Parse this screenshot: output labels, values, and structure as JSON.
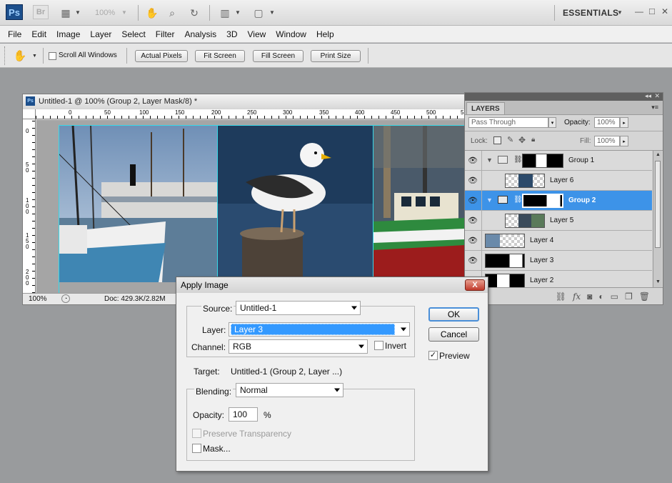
{
  "appbar": {
    "ps_logo": "Ps",
    "br_logo": "Br",
    "zoom": "100%",
    "workspace": "ESSENTIALS",
    "win_min": "—",
    "win_max": "□",
    "win_close": "✕"
  },
  "menu": [
    "File",
    "Edit",
    "Image",
    "Layer",
    "Select",
    "Filter",
    "Analysis",
    "3D",
    "View",
    "Window",
    "Help"
  ],
  "options": {
    "scroll_all": "Scroll All Windows",
    "actual_pixels": "Actual Pixels",
    "fit_screen": "Fit Screen",
    "fill_screen": "Fill Screen",
    "print_size": "Print Size"
  },
  "doc": {
    "title": "Untitled-1 @ 100% (Group 2, Layer Mask/8) *",
    "ruler_top": [
      "0",
      "50",
      "100",
      "150",
      "200",
      "250",
      "300",
      "350",
      "400",
      "450",
      "500",
      "550"
    ],
    "ruler_left": [
      "0",
      "5",
      "0",
      "1",
      "0",
      "0",
      "1",
      "5",
      "0",
      "2",
      "0",
      "0"
    ],
    "zoom": "100%",
    "status": "Doc: 429.3K/2.82M"
  },
  "layers": {
    "tab": "LAYERS",
    "blend_mode": "Pass Through",
    "opacity_label": "Opacity:",
    "opacity_value": "100%",
    "lock_label": "Lock:",
    "fill_label": "Fill:",
    "fill_value": "100%",
    "rows": [
      {
        "name": "Group 1"
      },
      {
        "name": "Layer 6"
      },
      {
        "name": "Group 2"
      },
      {
        "name": "Layer 5"
      },
      {
        "name": "Layer 4"
      },
      {
        "name": "Layer 3"
      },
      {
        "name": "Layer 2"
      }
    ],
    "footer_fx": "fx"
  },
  "dialog": {
    "title": "Apply Image",
    "close": "X",
    "source_label": "Source:",
    "source_value": "Untitled-1",
    "layer_label": "Layer:",
    "layer_value": "Layer 3",
    "channel_label": "Channel:",
    "channel_value": "RGB",
    "invert_label": "Invert",
    "target_label": "Target:",
    "target_value": "Untitled-1 (Group 2, Layer ...)",
    "blending_label": "Blending:",
    "blending_value": "Normal",
    "opacity_label": "Opacity:",
    "opacity_value": "100",
    "opacity_unit": "%",
    "preserve_label": "Preserve Transparency",
    "mask_label": "Mask...",
    "ok": "OK",
    "cancel": "Cancel",
    "preview_label": "Preview",
    "preview_checked": true
  }
}
